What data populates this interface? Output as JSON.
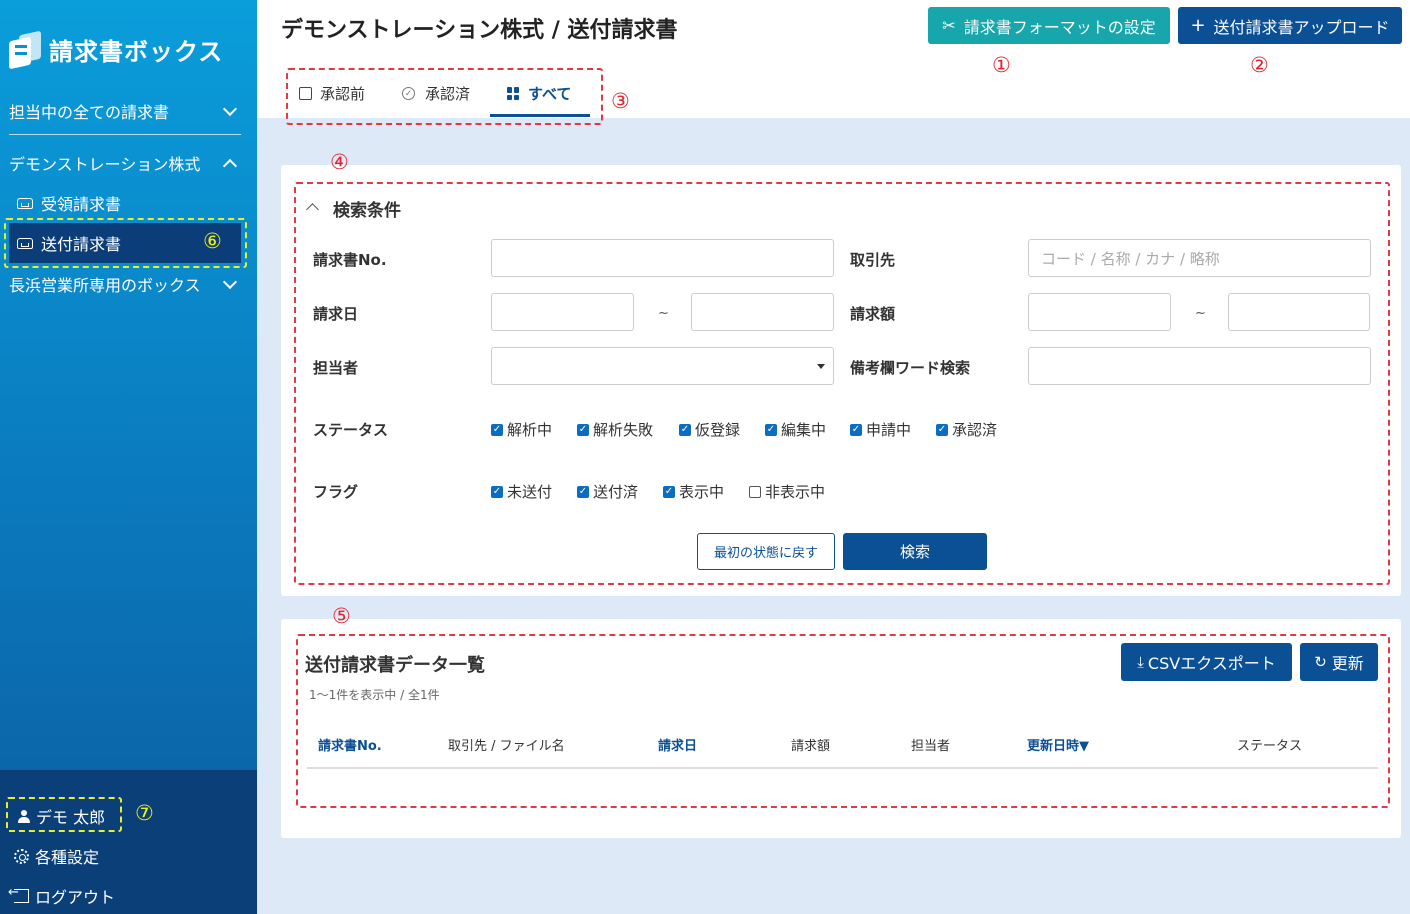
{
  "app": {
    "name": "請求書ボックス"
  },
  "sidebar": {
    "groups": [
      {
        "label": "担当中の全ての請求書"
      },
      {
        "label": "デモンストレーション株式"
      },
      {
        "label": "長浜営業所専用のボックス"
      }
    ],
    "items": [
      {
        "label": "受領請求書"
      },
      {
        "label": "送付請求書"
      }
    ],
    "user": {
      "name": "デモ 太郎",
      "settings_label": "各種設定",
      "logout_label": "ログアウト"
    }
  },
  "header": {
    "title": "デモンストレーション株式 / 送付請求書",
    "format_button": "請求書フォーマットの設定",
    "upload_button": "送付請求書アップロード"
  },
  "tabs": [
    {
      "label": "承認前"
    },
    {
      "label": "承認済"
    },
    {
      "label": "すべて"
    }
  ],
  "search": {
    "title": "検索条件",
    "labels": {
      "invoice_no": "請求書No.",
      "client": "取引先",
      "invoice_date": "請求日",
      "amount": "請求額",
      "assignee": "担当者",
      "memo": "備考欄ワード検索",
      "status": "ステータス",
      "flag": "フラグ"
    },
    "client_placeholder": "コード / 名称 / カナ / 略称",
    "range_sep": "~",
    "status_options": [
      {
        "label": "解析中",
        "checked": true
      },
      {
        "label": "解析失敗",
        "checked": true
      },
      {
        "label": "仮登録",
        "checked": true
      },
      {
        "label": "編集中",
        "checked": true
      },
      {
        "label": "申請中",
        "checked": true
      },
      {
        "label": "承認済",
        "checked": true
      }
    ],
    "flag_options": [
      {
        "label": "未送付",
        "checked": true
      },
      {
        "label": "送付済",
        "checked": true
      },
      {
        "label": "表示中",
        "checked": true
      },
      {
        "label": "非表示中",
        "checked": false
      }
    ],
    "reset_button": "最初の状態に戻す",
    "search_button": "検索"
  },
  "list": {
    "title": "送付請求書データ一覧",
    "summary": "1～1件を表示中 / 全1件",
    "csv_button": "CSVエクスポート",
    "refresh_button": "更新",
    "columns": [
      "請求書No.",
      "取引先 / ファイル名",
      "請求日",
      "請求額",
      "担当者",
      "更新日時▼",
      "ステータス"
    ]
  },
  "annotations": [
    "①",
    "②",
    "③",
    "④",
    "⑤",
    "⑥",
    "⑦"
  ],
  "colors": {
    "accent": "#0b4f94",
    "teal": "#18a6ad",
    "highlight_red": "#e23945",
    "highlight_yellow": "#e4ef30"
  }
}
